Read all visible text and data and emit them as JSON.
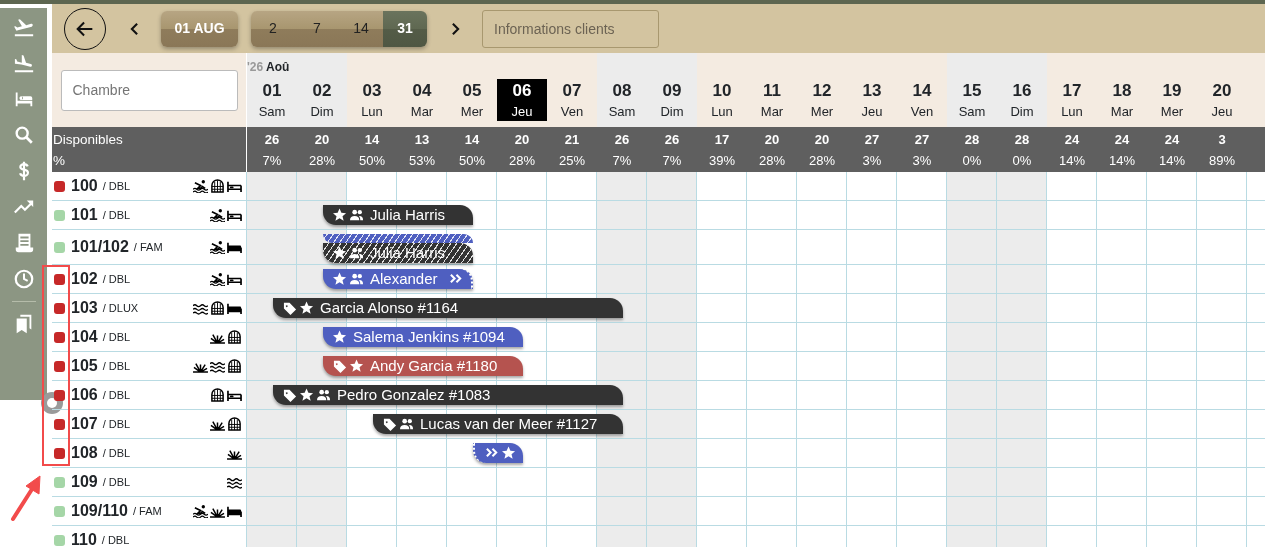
{
  "sidebar": {
    "items": [
      {
        "kind": "departure"
      },
      {
        "kind": "arrival"
      },
      {
        "kind": "bed"
      },
      {
        "kind": "search"
      },
      {
        "kind": "dollar"
      },
      {
        "kind": "trend"
      },
      {
        "kind": "receipt"
      },
      {
        "kind": "clock"
      },
      {
        "kind": "divider"
      },
      {
        "kind": "bookmarks"
      }
    ]
  },
  "toolbar": {
    "date_button": "01 AUG",
    "ranges": [
      {
        "label": "2",
        "selected": false
      },
      {
        "label": "7",
        "selected": false
      },
      {
        "label": "14",
        "selected": false
      },
      {
        "label": "31",
        "selected": true
      }
    ],
    "search": {
      "placeholder": "Informations clients"
    }
  },
  "room_search": {
    "placeholder": "Chambre"
  },
  "header": {
    "year": "'26",
    "month": "Aoû",
    "available_label": "Disponibles",
    "percent_label": "%"
  },
  "days": [
    {
      "day": "01",
      "weekday": "Sam",
      "weekend": true,
      "selected": false,
      "available": "26",
      "percent": "7%"
    },
    {
      "day": "02",
      "weekday": "Dim",
      "weekend": true,
      "selected": false,
      "available": "20",
      "percent": "28%"
    },
    {
      "day": "03",
      "weekday": "Lun",
      "weekend": false,
      "selected": false,
      "available": "14",
      "percent": "50%"
    },
    {
      "day": "04",
      "weekday": "Mar",
      "weekend": false,
      "selected": false,
      "available": "13",
      "percent": "53%"
    },
    {
      "day": "05",
      "weekday": "Mer",
      "weekend": false,
      "selected": false,
      "available": "14",
      "percent": "50%"
    },
    {
      "day": "06",
      "weekday": "Jeu",
      "weekend": false,
      "selected": true,
      "available": "20",
      "percent": "28%"
    },
    {
      "day": "07",
      "weekday": "Ven",
      "weekend": false,
      "selected": false,
      "available": "21",
      "percent": "25%"
    },
    {
      "day": "08",
      "weekday": "Sam",
      "weekend": true,
      "selected": false,
      "available": "26",
      "percent": "7%"
    },
    {
      "day": "09",
      "weekday": "Dim",
      "weekend": true,
      "selected": false,
      "available": "26",
      "percent": "7%"
    },
    {
      "day": "10",
      "weekday": "Lun",
      "weekend": false,
      "selected": false,
      "available": "17",
      "percent": "39%"
    },
    {
      "day": "11",
      "weekday": "Mar",
      "weekend": false,
      "selected": false,
      "available": "20",
      "percent": "28%"
    },
    {
      "day": "12",
      "weekday": "Mer",
      "weekend": false,
      "selected": false,
      "available": "20",
      "percent": "28%"
    },
    {
      "day": "13",
      "weekday": "Jeu",
      "weekend": false,
      "selected": false,
      "available": "27",
      "percent": "3%"
    },
    {
      "day": "14",
      "weekday": "Ven",
      "weekend": false,
      "selected": false,
      "available": "27",
      "percent": "3%"
    },
    {
      "day": "15",
      "weekday": "Sam",
      "weekend": true,
      "selected": false,
      "available": "28",
      "percent": "0%"
    },
    {
      "day": "16",
      "weekday": "Dim",
      "weekend": true,
      "selected": false,
      "available": "28",
      "percent": "0%"
    },
    {
      "day": "17",
      "weekday": "Lun",
      "weekend": false,
      "selected": false,
      "available": "24",
      "percent": "14%"
    },
    {
      "day": "18",
      "weekday": "Mar",
      "weekend": false,
      "selected": false,
      "available": "24",
      "percent": "14%"
    },
    {
      "day": "19",
      "weekday": "Mer",
      "weekend": false,
      "selected": false,
      "available": "24",
      "percent": "14%"
    },
    {
      "day": "20",
      "weekday": "Jeu",
      "weekend": false,
      "selected": false,
      "available": "3",
      "percent": "89%"
    }
  ],
  "rooms": [
    {
      "number": "100",
      "type": "/ DBL",
      "color": "#c62828",
      "icons": [
        {
          "kind": "swimmer"
        },
        {
          "kind": "window"
        },
        {
          "kind": "bed"
        }
      ]
    },
    {
      "number": "101",
      "type": "/ DBL",
      "color": "#a5d6a7",
      "icons": [
        {
          "kind": "swimmer"
        },
        {
          "kind": "bed"
        }
      ],
      "lanes": [
        {
          "items": [
            {
              "kind": "free"
            },
            {
              "kind": "booking",
              "name": "Julia Harris",
              "color": "#333333",
              "hatched": false,
              "icons": [
                {
                  "kind": "star"
                },
                {
                  "kind": "group"
                }
              ],
              "nights": [
                {
                  "kind": "night"
                },
                {
                  "kind": "night"
                },
                {
                  "kind": "night"
                }
              ]
            }
          ]
        }
      ]
    },
    {
      "number": "101/102",
      "type": "/ FAM",
      "color": "#a5d6a7",
      "icons": [
        {
          "kind": "swimmer"
        },
        {
          "kind": "bed-filled"
        }
      ],
      "lanes": [
        {
          "items": [
            {
              "kind": "free"
            },
            {
              "kind": "booking",
              "color": "#4f5fc0",
              "hatched": true,
              "nights": [
                {
                  "kind": "night"
                },
                {
                  "kind": "night"
                },
                {
                  "kind": "night"
                }
              ]
            }
          ]
        },
        {
          "items": [
            {
              "kind": "free"
            },
            {
              "kind": "booking",
              "name": "Julia Harris",
              "color": "#333333",
              "hatched": true,
              "icons": [
                {
                  "kind": "star"
                },
                {
                  "kind": "group"
                }
              ],
              "nights": [
                {
                  "kind": "night"
                },
                {
                  "kind": "night"
                },
                {
                  "kind": "night"
                }
              ]
            }
          ]
        }
      ]
    },
    {
      "number": "102",
      "type": "/ DBL",
      "color": "#c62828",
      "icons": [
        {
          "kind": "swimmer"
        },
        {
          "kind": "bed"
        }
      ],
      "lanes": [
        {
          "items": [
            {
              "kind": "free"
            },
            {
              "kind": "booking",
              "name": "Alexander",
              "color": "#4f5fc0",
              "hatched": false,
              "nights": [
                {
                  "kind": "night"
                },
                {
                  "kind": "night"
                },
                {
                  "kind": "night"
                }
              ],
              "icons": [
                {
                  "kind": "star"
                },
                {
                  "kind": "group"
                }
              ],
              "end_icons": [
                {
                  "kind": "continues"
                }
              ]
            }
          ]
        }
      ]
    },
    {
      "number": "103",
      "type": "/ DLUX",
      "color": "#c62828",
      "icons": [
        {
          "kind": "waves"
        },
        {
          "kind": "window"
        },
        {
          "kind": "bed-filled"
        }
      ],
      "lanes": [
        {
          "items": [
            {
              "kind": "booking",
              "name": "Garcia Alonso #1164",
              "color": "#333333",
              "hatched": false,
              "icons": [
                {
                  "kind": "tag"
                },
                {
                  "kind": "star"
                }
              ],
              "nights": [
                {
                  "kind": "night"
                },
                {
                  "kind": "night"
                },
                {
                  "kind": "night"
                },
                {
                  "kind": "night"
                },
                {
                  "kind": "night"
                },
                {
                  "kind": "night"
                },
                {
                  "kind": "night"
                }
              ]
            }
          ]
        }
      ]
    },
    {
      "number": "104",
      "type": "/ DBL",
      "color": "#c62828",
      "icons": [
        {
          "kind": "plant"
        },
        {
          "kind": "window"
        }
      ],
      "lanes": [
        {
          "items": [
            {
              "kind": "free"
            },
            {
              "kind": "booking",
              "name": "Salema Jenkins #1094",
              "color": "#4f5fc0",
              "hatched": false,
              "icons": [
                {
                  "kind": "star"
                }
              ],
              "nights": [
                {
                  "kind": "night"
                },
                {
                  "kind": "night"
                },
                {
                  "kind": "night"
                },
                {
                  "kind": "night"
                }
              ]
            }
          ]
        }
      ]
    },
    {
      "number": "105",
      "type": "/ DBL",
      "color": "#c62828",
      "icons": [
        {
          "kind": "plant"
        },
        {
          "kind": "waves"
        },
        {
          "kind": "window"
        }
      ],
      "lanes": [
        {
          "items": [
            {
              "kind": "free"
            },
            {
              "kind": "booking",
              "name": "Andy Garcia #1180",
              "color": "#b5534f",
              "hatched": false,
              "icons": [
                {
                  "kind": "tag"
                },
                {
                  "kind": "star"
                }
              ],
              "nights": [
                {
                  "kind": "night"
                },
                {
                  "kind": "night"
                },
                {
                  "kind": "night"
                },
                {
                  "kind": "night"
                }
              ]
            }
          ]
        }
      ]
    },
    {
      "number": "106",
      "type": "/ DBL",
      "color": "#c62828",
      "icons": [
        {
          "kind": "window"
        },
        {
          "kind": "bed"
        }
      ],
      "lanes": [
        {
          "items": [
            {
              "kind": "booking",
              "name": "Pedro Gonzalez #1083",
              "color": "#333333",
              "hatched": false,
              "icons": [
                {
                  "kind": "tag"
                },
                {
                  "kind": "star"
                },
                {
                  "kind": "group"
                }
              ],
              "nights": [
                {
                  "kind": "night"
                },
                {
                  "kind": "night"
                },
                {
                  "kind": "night"
                },
                {
                  "kind": "night"
                },
                {
                  "kind": "night"
                },
                {
                  "kind": "night"
                },
                {
                  "kind": "night"
                }
              ]
            }
          ]
        }
      ]
    },
    {
      "number": "107",
      "type": "/ DBL",
      "color": "#c62828",
      "icons": [
        {
          "kind": "plant"
        },
        {
          "kind": "window"
        }
      ],
      "lanes": [
        {
          "items": [
            {
              "kind": "free"
            },
            {
              "kind": "free"
            },
            {
              "kind": "booking",
              "name": "Lucas van der Meer #1127",
              "color": "#333333",
              "hatched": false,
              "icons": [
                {
                  "kind": "tag"
                },
                {
                  "kind": "group"
                }
              ],
              "nights": [
                {
                  "kind": "night"
                },
                {
                  "kind": "night"
                },
                {
                  "kind": "night"
                },
                {
                  "kind": "night"
                },
                {
                  "kind": "night"
                }
              ]
            }
          ]
        }
      ]
    },
    {
      "number": "108",
      "type": "/ DBL",
      "color": "#c62828",
      "icons": [
        {
          "kind": "plant"
        }
      ],
      "lanes": [
        {
          "items": [
            {
              "kind": "free"
            },
            {
              "kind": "free"
            },
            {
              "kind": "free"
            },
            {
              "kind": "free"
            },
            {
              "kind": "booking",
              "color": "#4f5fc0",
              "hatched": false,
              "icons": [
                {
                  "kind": "continues"
                },
                {
                  "kind": "star"
                }
              ],
              "nights": [
                {
                  "kind": "night"
                }
              ]
            }
          ]
        }
      ]
    },
    {
      "number": "109",
      "type": "/ DBL",
      "color": "#a5d6a7",
      "icons": [
        {
          "kind": "waves"
        }
      ]
    },
    {
      "number": "109/110",
      "type": "/ FAM",
      "color": "#a5d6a7",
      "icons": [
        {
          "kind": "swimmer"
        },
        {
          "kind": "plant"
        },
        {
          "kind": "bed-filled"
        }
      ]
    },
    {
      "number": "110",
      "type": "/ DBL",
      "color": "#a5d6a7"
    }
  ]
}
